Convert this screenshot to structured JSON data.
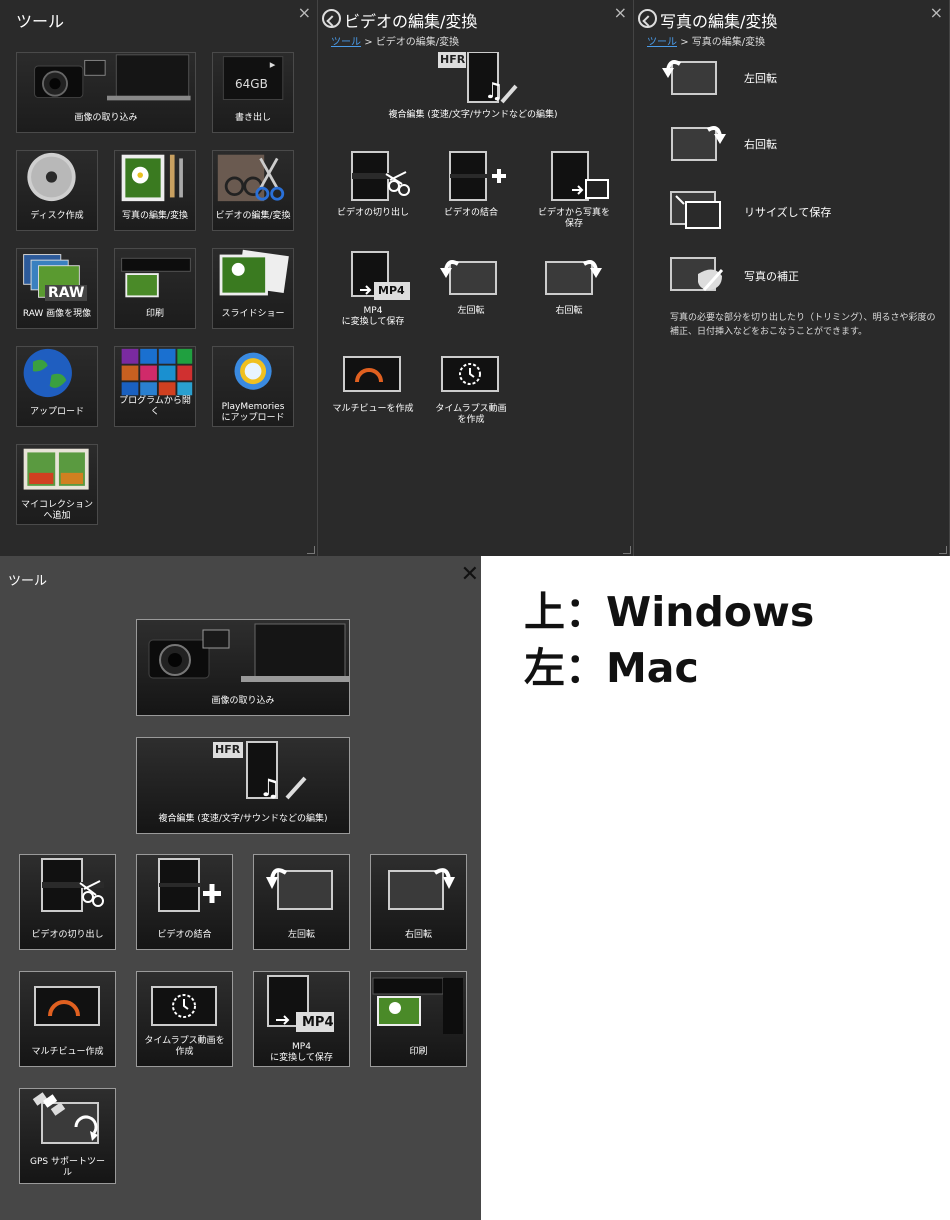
{
  "windows": {
    "tools_panel": {
      "title": "ツール",
      "close_icon": "×",
      "tiles": [
        {
          "label": "画像の取り込み",
          "icon": "camera-laptop-icon"
        },
        {
          "label": "書き出し",
          "icon": "sd-card-icon",
          "card_text": "64GB"
        },
        {
          "label": "ディスク作成",
          "icon": "disc-icon"
        },
        {
          "label": "写真の編集/変換",
          "icon": "photo-edit-icon"
        },
        {
          "label": "ビデオの編集/変換",
          "icon": "video-edit-icon"
        },
        {
          "label": "RAW 画像を現像",
          "icon": "raw-icon",
          "badge": "RAW"
        },
        {
          "label": "印刷",
          "icon": "printer-icon"
        },
        {
          "label": "スライドショー",
          "icon": "slideshow-icon"
        },
        {
          "label": "アップロード",
          "icon": "globe-icon"
        },
        {
          "label": "プログラムから開く",
          "icon": "app-tiles-icon"
        },
        {
          "label": "PlayMemories\nにアップロード",
          "icon": "playmemories-icon"
        },
        {
          "label": "マイコレクション\nへ追加",
          "icon": "window-collection-icon"
        }
      ]
    },
    "video_panel": {
      "title": "ビデオの編集/変換",
      "breadcrumb_root": "ツール",
      "breadcrumb_sep": ">",
      "breadcrumb_current": "ビデオの編集/変換",
      "composite": {
        "label": "複合編集 (変速/文字/サウンドなどの編集)",
        "badge": "HFR"
      },
      "functions": [
        {
          "label": "ビデオの切り出し",
          "icon": "scissors-film-icon"
        },
        {
          "label": "ビデオの結合",
          "icon": "film-plus-icon"
        },
        {
          "label": "ビデオから写真を\n保存",
          "icon": "film-to-photo-icon"
        },
        {
          "label": "MP4\nに変換して保存",
          "icon": "mp4-convert-icon",
          "badge": "MP4"
        },
        {
          "label": "左回転",
          "icon": "rotate-left-icon"
        },
        {
          "label": "右回転",
          "icon": "rotate-right-icon"
        },
        {
          "label": "マルチビューを作成",
          "icon": "multiview-icon"
        },
        {
          "label": "タイムラプス動画\nを作成",
          "icon": "timelapse-icon"
        }
      ],
      "close_icon": "×"
    },
    "photo_panel": {
      "title": "写真の編集/変換",
      "breadcrumb_root": "ツール",
      "breadcrumb_sep": ">",
      "breadcrumb_current": "写真の編集/変換",
      "items": [
        {
          "label": "左回転",
          "icon": "rotate-left-icon"
        },
        {
          "label": "右回転",
          "icon": "rotate-right-icon"
        },
        {
          "label": "リサイズして保存",
          "icon": "resize-icon"
        },
        {
          "label": "写真の補正",
          "icon": "palette-icon"
        }
      ],
      "description": "写真の必要な部分を切り出したり（トリミング）、明るさや彩度の補正、日付挿入などをおこなうことができます。",
      "close_icon": "×"
    }
  },
  "mac": {
    "title": "ツール",
    "close_icon": "✕",
    "tiles": [
      {
        "label": "画像の取り込み",
        "icon": "camera-laptop-icon"
      },
      {
        "label": "複合編集 (変速/文字/サウンドなどの編集)",
        "icon": "hfr-music-icon",
        "badge": "HFR"
      },
      {
        "label": "ビデオの切り出し",
        "icon": "scissors-film-icon"
      },
      {
        "label": "ビデオの結合",
        "icon": "film-plus-icon"
      },
      {
        "label": "左回転",
        "icon": "rotate-left-icon"
      },
      {
        "label": "右回転",
        "icon": "rotate-right-icon"
      },
      {
        "label": "マルチビュー作成",
        "icon": "multiview-icon"
      },
      {
        "label": "タイムラプス動画を\n作成",
        "icon": "timelapse-icon"
      },
      {
        "label": "MP4\nに変換して保存",
        "icon": "mp4-convert-icon",
        "badge": "MP4"
      },
      {
        "label": "印刷",
        "icon": "printer-icon"
      },
      {
        "label": "GPS サポートツー\nル",
        "icon": "gps-satellite-icon"
      }
    ]
  },
  "note": {
    "line1": "上：Windows",
    "line2": "左：Mac"
  }
}
